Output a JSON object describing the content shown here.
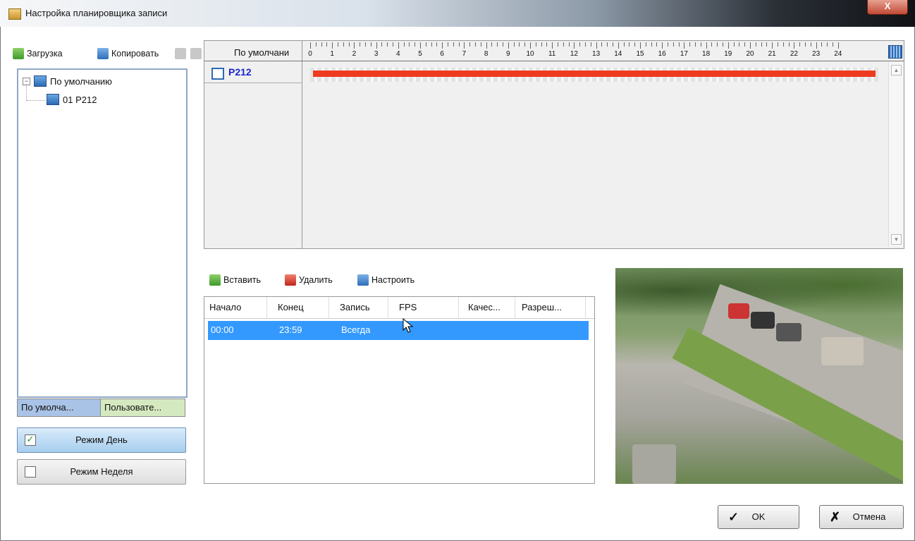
{
  "window": {
    "title": "Настройка планировщика записи",
    "close_label": "X"
  },
  "toolbar": {
    "load_label": "Загрузка",
    "copy_label": "Копировать"
  },
  "tree": {
    "root_label": "По умолчанию",
    "child_label": "01 P212"
  },
  "tabs": {
    "default_label": "По умолча...",
    "user_label": "Пользовате..."
  },
  "modes": {
    "day_label": "Режим День",
    "day_checked": true,
    "week_label": "Режим Неделя",
    "week_checked": false
  },
  "schedule": {
    "header_label": "По умолчани",
    "hours": [
      "0",
      "1",
      "2",
      "3",
      "4",
      "5",
      "6",
      "7",
      "8",
      "9",
      "10",
      "11",
      "12",
      "13",
      "14",
      "15",
      "16",
      "17",
      "18",
      "19",
      "20",
      "21",
      "22",
      "23",
      "24"
    ],
    "camera_name": "P212",
    "record_bar": {
      "from_hour": 0,
      "to_hour": 24,
      "color": "#ee3b1f"
    }
  },
  "actions": {
    "insert_label": "Вставить",
    "delete_label": "Удалить",
    "configure_label": "Настроить"
  },
  "table": {
    "columns": [
      "Начало",
      "Конец",
      "Запись",
      "FPS",
      "Качес...",
      "Разреш..."
    ],
    "rows": [
      {
        "start": "00:00",
        "end": "23:59",
        "record": "Всегда",
        "fps": "",
        "quality": "",
        "resolution": ""
      }
    ]
  },
  "dialog": {
    "ok_label": "OK",
    "cancel_label": "Отмена"
  },
  "colors": {
    "selection": "#3399ff",
    "camera_name": "#1c27c9",
    "record_bar": "#ee3b1f"
  }
}
